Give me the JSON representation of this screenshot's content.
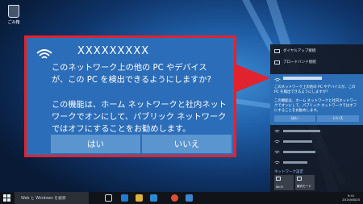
{
  "desktop": {
    "recycle_bin_label": "ごみ箱"
  },
  "callout": {
    "network_name": "XXXXXXXXX",
    "question": "このネットワーク上の他の PC やデバイスが、この PC を検出できるようにしますか?",
    "detail": "この機能は、ホーム ネットワークと社内ネットワークでオンにして、パブリック ネットワークではオフにすることをお勧めします。",
    "yes_label": "はい",
    "no_label": "いいえ"
  },
  "panel": {
    "items": [
      {
        "label": "ダイヤルアップ接続"
      },
      {
        "label": "ブロードバンド接続"
      }
    ],
    "mini_question": "このネットワーク上の他の PC やデバイスが、この PC を検出できるようにしますか?",
    "mini_detail": "この機能は、ホーム ネットワークと社内ネットワークでオンにして、パブリック ネットワークではオフにすることをお勧めします。",
    "mini_yes": "はい",
    "mini_no": "いいえ",
    "settings_label": "ネットワーク設定",
    "tiles": [
      {
        "label": "Wi-Fi"
      },
      {
        "label": "機内モード"
      }
    ]
  },
  "taskbar": {
    "search_placeholder": "Web と Windows を検索",
    "time": "9:41",
    "date": "2015/08/20"
  },
  "colors": {
    "highlight_red": "#e0232e",
    "dialog_blue": "#2b6db8",
    "button_blue": "#5b95cf"
  }
}
